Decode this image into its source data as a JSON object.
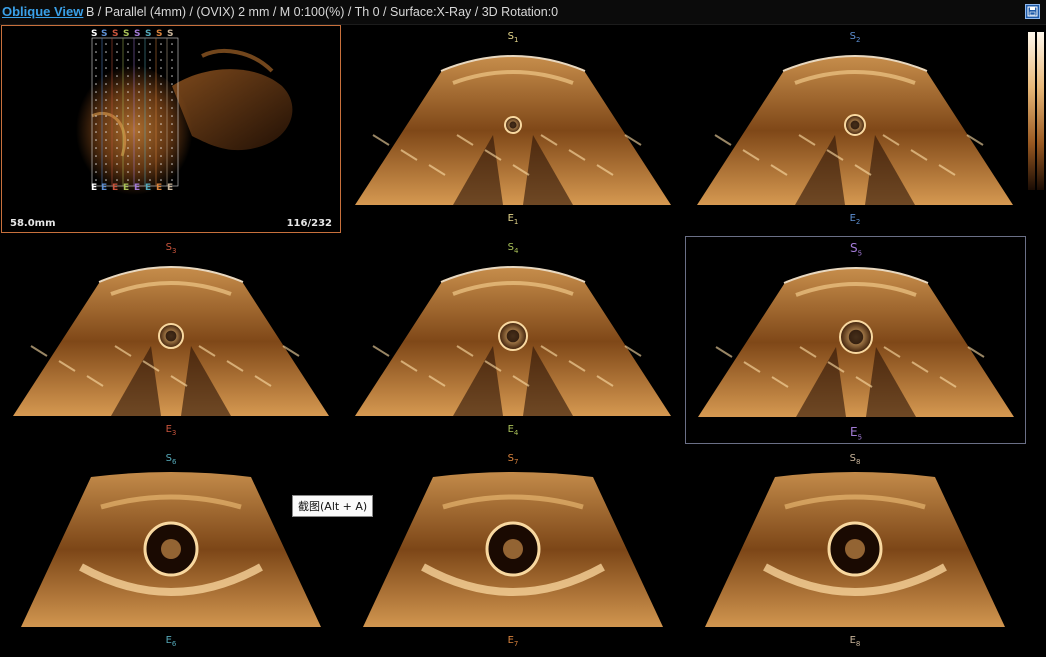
{
  "header": {
    "title": "Oblique View",
    "params": "B / Parallel (4mm) / (OVIX) 2 mm / M 0:100(%) / Th 0 / Surface:X-Ray / 3D Rotation:0",
    "save_icon": "save-icon"
  },
  "overview": {
    "depth": "58.0mm",
    "frame": "116/232",
    "top_markers": [
      "S",
      "S",
      "S",
      "S",
      "S",
      "S",
      "S",
      "S"
    ],
    "bottom_markers": [
      "E",
      "E",
      "E",
      "E",
      "E",
      "E",
      "E",
      "E"
    ]
  },
  "slices": [
    {
      "s": "S",
      "s_sub": "1",
      "e": "E",
      "e_sub": "1",
      "color": "#e3d48a"
    },
    {
      "s": "S",
      "s_sub": "2",
      "e": "E",
      "e_sub": "2",
      "color": "#5d8fd2"
    },
    {
      "s": "S",
      "s_sub": "3",
      "e": "E",
      "e_sub": "3",
      "color": "#c8543c"
    },
    {
      "s": "S",
      "s_sub": "4",
      "e": "E",
      "e_sub": "4",
      "color": "#a8c058"
    },
    {
      "s": "S",
      "s_sub": "5",
      "e": "E",
      "e_sub": "5",
      "color": "#a27ad6"
    },
    {
      "s": "S",
      "s_sub": "6",
      "e": "E",
      "e_sub": "6",
      "color": "#55a8b8"
    },
    {
      "s": "S",
      "s_sub": "7",
      "e": "E",
      "e_sub": "7",
      "color": "#d8823c"
    },
    {
      "s": "S",
      "s_sub": "8",
      "e": "E",
      "e_sub": "8",
      "color": "#c8b49a"
    }
  ],
  "tooltip": "截图(Alt + A)",
  "colors": {
    "accent": "#3aa0e8",
    "overview_border": "#c8703c",
    "selected_border": "#6a6f86"
  }
}
